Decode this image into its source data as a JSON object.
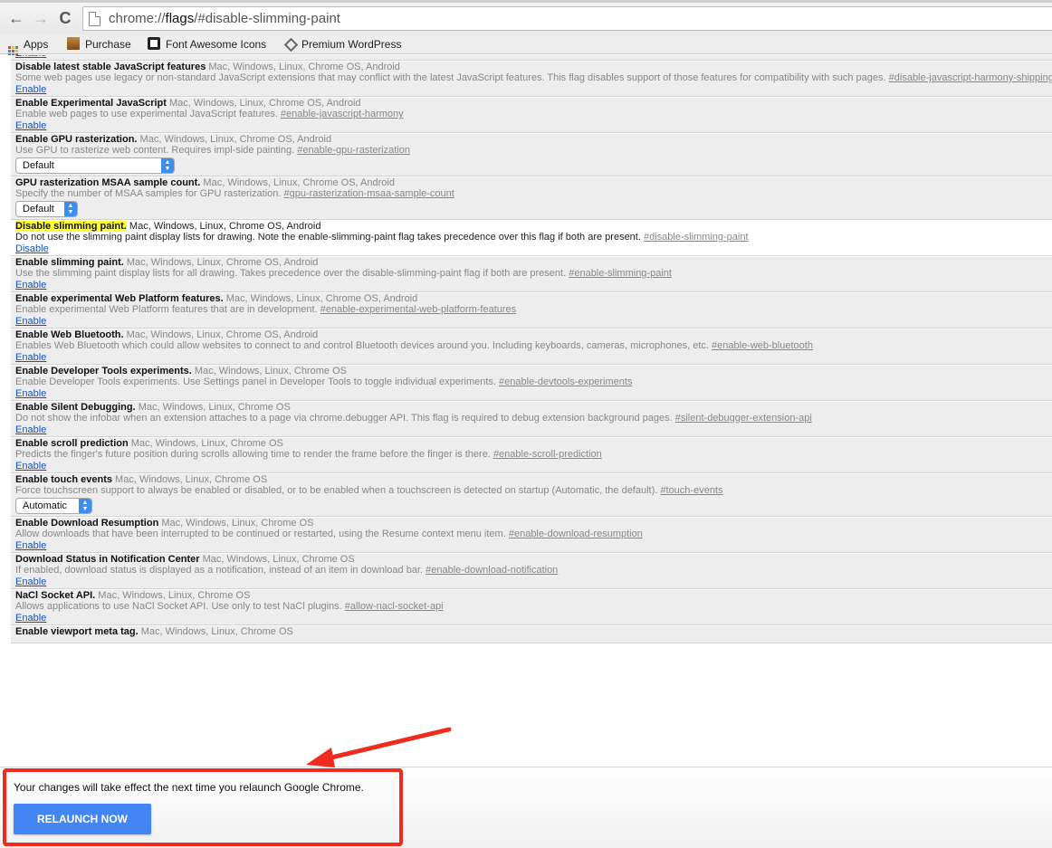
{
  "toolbar": {
    "back_glyph": "←",
    "forward_glyph": "→",
    "reload_glyph": "C",
    "url_prefix": "chrome://",
    "url_host": "flags",
    "url_path": "/#disable-slimming-paint"
  },
  "bookmarks": [
    {
      "label": "Apps",
      "icon": "apps-grid-icon"
    },
    {
      "label": "Purchase",
      "icon": "purchase-bookmark-icon"
    },
    {
      "label": "Font Awesome Icons",
      "icon": "flag-icon"
    },
    {
      "label": "Premium WordPress",
      "icon": "wordpress-diamond-icon"
    }
  ],
  "flags": [
    {
      "title": "",
      "platforms": "",
      "description": "",
      "tag": "",
      "control": "link",
      "value": "Enable"
    },
    {
      "title": "Disable latest stable JavaScript features",
      "platforms": "Mac, Windows, Linux, Chrome OS, Android",
      "description": "Some web pages use legacy or non-standard JavaScript extensions that may conflict with the latest JavaScript features. This flag disables support of those features for compatibility with such pages.",
      "tag": "#disable-javascript-harmony-shipping",
      "control": "link",
      "value": "Enable"
    },
    {
      "title": "Enable Experimental JavaScript",
      "platforms": "Mac, Windows, Linux, Chrome OS, Android",
      "description": "Enable web pages to use experimental JavaScript features.",
      "tag": "#enable-javascript-harmony",
      "control": "link",
      "value": "Enable"
    },
    {
      "title": "Enable GPU rasterization.",
      "platforms": "Mac, Windows, Linux, Chrome OS, Android",
      "description": "Use GPU to rasterize web content. Requires impl-side painting.",
      "tag": "#enable-gpu-rasterization",
      "control": "select",
      "value": "Default",
      "select_width": 176
    },
    {
      "title": "GPU rasterization MSAA sample count.",
      "platforms": "Mac, Windows, Linux, Chrome OS, Android",
      "description": "Specify the number of MSAA samples for GPU rasterization.",
      "tag": "#gpu-rasterization-msaa-sample-count",
      "control": "select",
      "value": "Default",
      "select_width": 69
    },
    {
      "title": "Disable slimming paint.",
      "platforms": "Mac, Windows, Linux, Chrome OS, Android",
      "description": "Do not use the slimming paint display lists for drawing. Note the enable-slimming-paint flag takes precedence over this flag if both are present.",
      "tag": "#disable-slimming-paint",
      "control": "link",
      "value": "Disable",
      "active": true
    },
    {
      "title": "Enable slimming paint.",
      "platforms": "Mac, Windows, Linux, Chrome OS, Android",
      "description": "Use the slimming paint display lists for all drawing. Takes precedence over the disable-slimming-paint flag if both are present.",
      "tag": "#enable-slimming-paint",
      "control": "link",
      "value": "Enable"
    },
    {
      "title": "Enable experimental Web Platform features.",
      "platforms": "Mac, Windows, Linux, Chrome OS, Android",
      "description": "Enable experimental Web Platform features that are in development.",
      "tag": "#enable-experimental-web-platform-features",
      "control": "link",
      "value": "Enable"
    },
    {
      "title": "Enable Web Bluetooth.",
      "platforms": "Mac, Windows, Linux, Chrome OS, Android",
      "description": "Enables Web Bluetooth which could allow websites to connect to and control Bluetooth devices around you. Including keyboards, cameras, microphones, etc.",
      "tag": "#enable-web-bluetooth",
      "control": "link",
      "value": "Enable"
    },
    {
      "title": "Enable Developer Tools experiments.",
      "platforms": "Mac, Windows, Linux, Chrome OS",
      "description": "Enable Developer Tools experiments. Use Settings panel in Developer Tools to toggle individual experiments.",
      "tag": "#enable-devtools-experiments",
      "control": "link",
      "value": "Enable"
    },
    {
      "title": "Enable Silent Debugging.",
      "platforms": "Mac, Windows, Linux, Chrome OS",
      "description": "Do not show the infobar when an extension attaches to a page via chrome.debugger API. This flag is required to debug extension background pages.",
      "tag": "#silent-debugger-extension-api",
      "control": "link",
      "value": "Enable"
    },
    {
      "title": "Enable scroll prediction",
      "platforms": "Mac, Windows, Linux, Chrome OS",
      "description": "Predicts the finger's future position during scrolls allowing time to render the frame before the finger is there.",
      "tag": "#enable-scroll-prediction",
      "control": "link",
      "value": "Enable"
    },
    {
      "title": "Enable touch events",
      "platforms": "Mac, Windows, Linux, Chrome OS",
      "description": "Force touchscreen support to always be enabled or disabled, or to be enabled when a touchscreen is detected on startup (Automatic, the default).",
      "tag": "#touch-events",
      "control": "select",
      "value": "Automatic",
      "select_width": 85
    },
    {
      "title": "Enable Download Resumption",
      "platforms": "Mac, Windows, Linux, Chrome OS",
      "description": "Allow downloads that have been interrupted to be continued or restarted, using the Resume context menu item.",
      "tag": "#enable-download-resumption",
      "control": "link",
      "value": "Enable"
    },
    {
      "title": "Download Status in Notification Center",
      "platforms": "Mac, Windows, Linux, Chrome OS",
      "description": "If enabled, download status is displayed as a notification, instead of an item in download bar.",
      "tag": "#enable-download-notification",
      "control": "link",
      "value": "Enable"
    },
    {
      "title": "NaCl Socket API.",
      "platforms": "Mac, Windows, Linux, Chrome OS",
      "description": "Allows applications to use NaCl Socket API. Use only to test NaCl plugins.",
      "tag": "#allow-nacl-socket-api",
      "control": "link",
      "value": "Enable"
    },
    {
      "title": "Enable viewport meta tag.",
      "platforms": "Mac, Windows, Linux, Chrome OS",
      "description": "",
      "tag": "",
      "control": "none",
      "value": ""
    }
  ],
  "relaunch": {
    "message": "Your changes will take effect the next time you relaunch Google Chrome.",
    "button_label": "RELAUNCH NOW"
  },
  "colors": {
    "highlight": "#ffff33",
    "annotation_red": "#ef2a1e",
    "relaunch_blue": "#4285f4",
    "link_blue": "#1155cc"
  }
}
